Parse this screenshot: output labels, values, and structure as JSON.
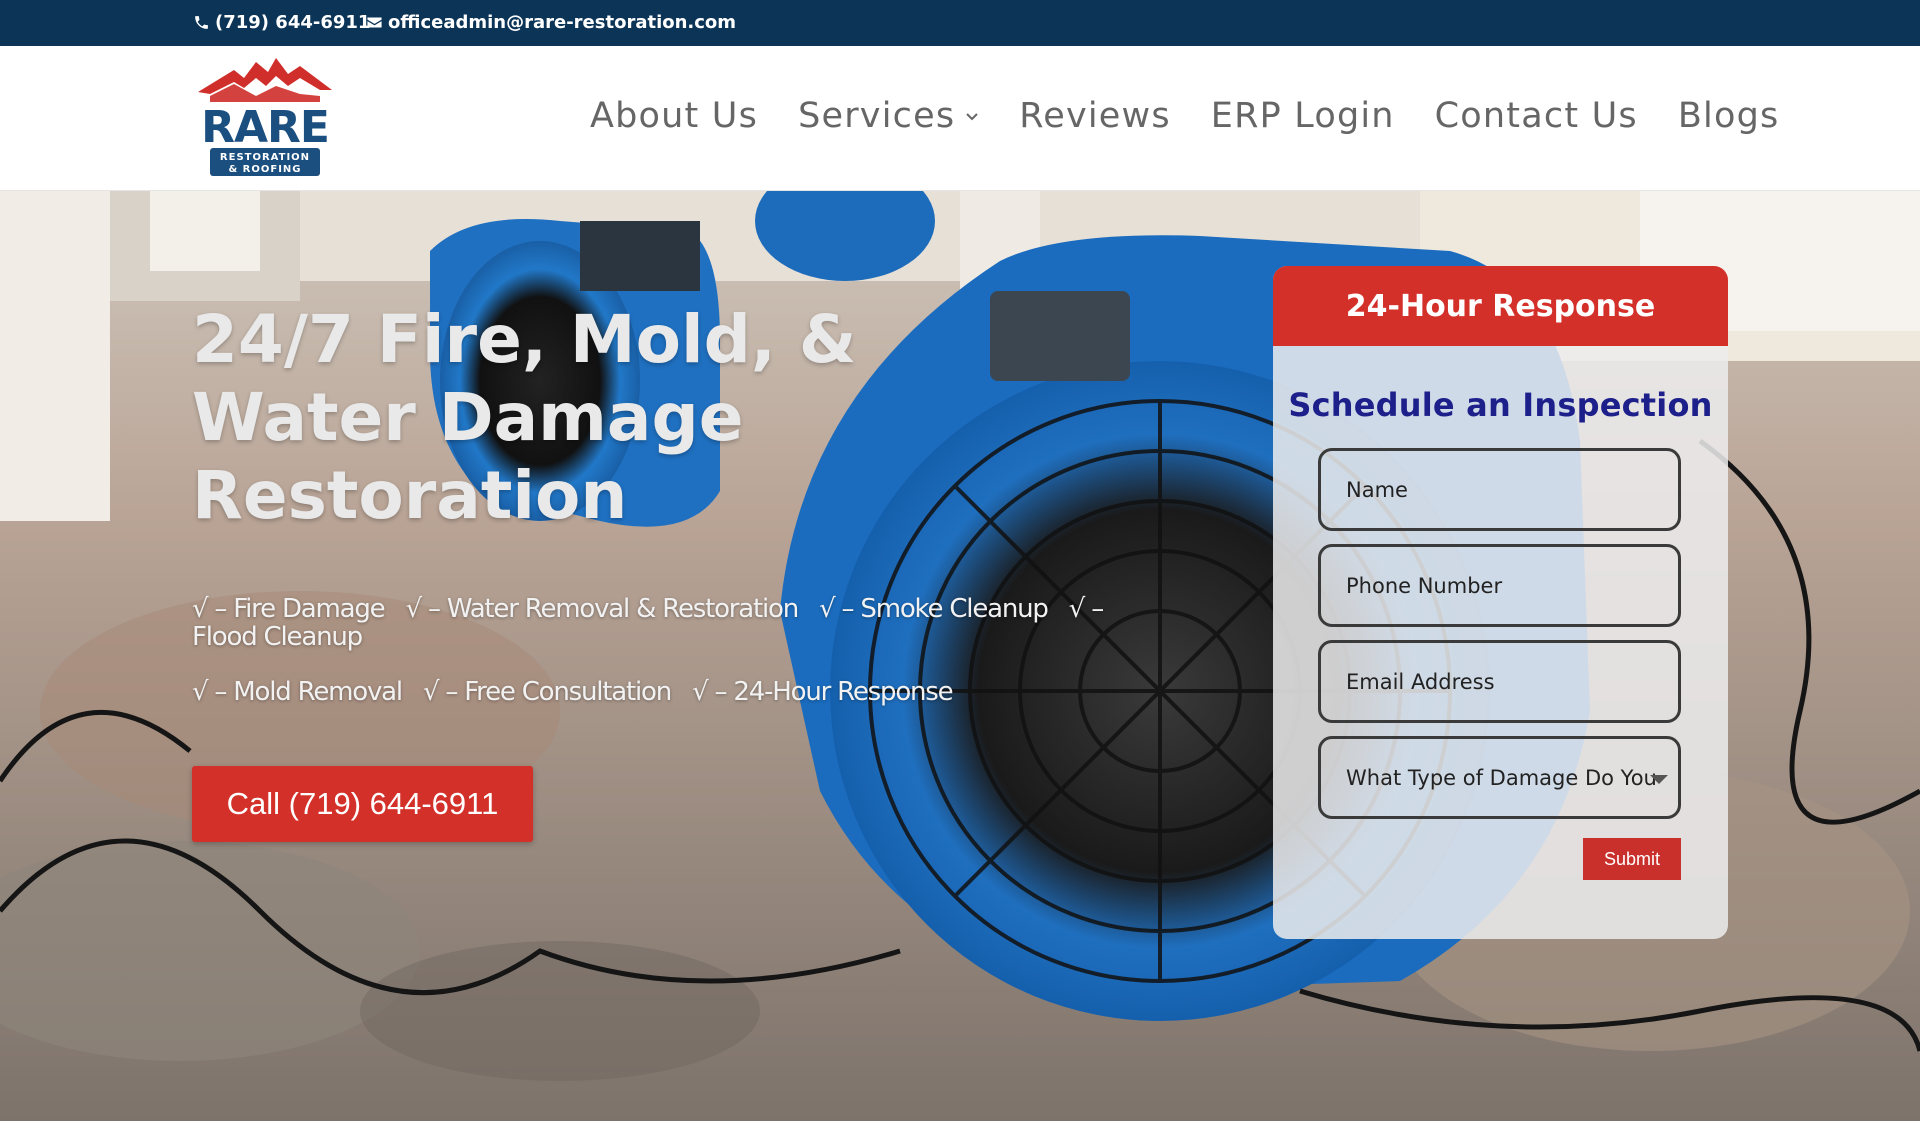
{
  "topbar": {
    "phone": "(719) 644-6911",
    "email": "officeadmin@rare-restoration.com"
  },
  "logo": {
    "name": "RARE",
    "tagline_line1": "RESTORATION",
    "tagline_line2": "& ROOFING"
  },
  "nav": {
    "items": [
      {
        "label": "About Us"
      },
      {
        "label": "Services"
      },
      {
        "label": "Reviews"
      },
      {
        "label": "ERP Login"
      },
      {
        "label": "Contact Us"
      },
      {
        "label": "Blogs"
      }
    ]
  },
  "hero": {
    "title": "24/7 Fire, Mold, & Water Damage Restoration",
    "features_line1": [
      "√ – Fire Damage",
      "√ – Water Removal & Restoration",
      "√ – Smoke Cleanup",
      "√ – Flood Cleanup"
    ],
    "features_line2": [
      "√ – Mold Removal",
      "√ – Free Consultation",
      "√ – 24-Hour Response"
    ],
    "call_button": "Call (719) 644-6911"
  },
  "form": {
    "header": "24-Hour Response",
    "title": "Schedule an Inspection",
    "name_placeholder": "Name",
    "phone_placeholder": "Phone Number",
    "email_placeholder": "Email Address",
    "damage_select": "What Type of Damage Do You",
    "submit": "Submit"
  },
  "colors": {
    "topbar_bg": "#0b3457",
    "brand_red": "#d3302a",
    "form_title": "#1d1f8a",
    "logo_blue": "#1b4f7f"
  },
  "icons": {
    "phone": "phone-icon",
    "email": "envelope-icon",
    "services": "chevron-down-icon",
    "select": "caret-down-icon"
  }
}
